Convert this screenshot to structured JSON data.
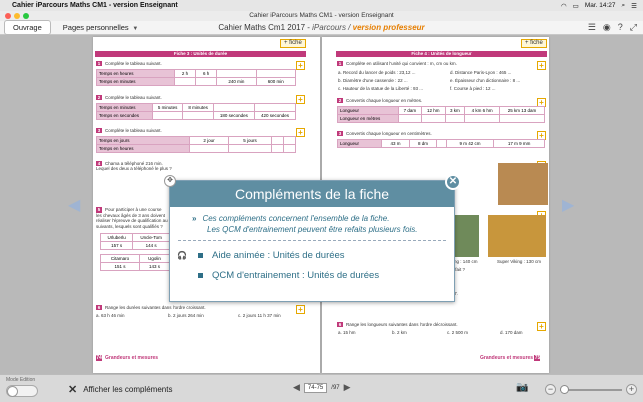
{
  "menubar": {
    "app_name": "Cahier iParcours Maths CM1 - version Enseignant",
    "right_items": [
      "Mar. 14:27"
    ]
  },
  "window": {
    "title": "Cahier iParcours Maths CM1 - version Enseignant"
  },
  "toolbar": {
    "tab_ouvrage": "Ouvrage",
    "tab_pages": "Pages personnelles",
    "doc_title_main": "Cahier Maths Cm1 2017 - ",
    "doc_title_sub": "iParcours / ",
    "doc_title_prof": "version professeur"
  },
  "left_page": {
    "section_title": "Fiche 3 : Unités de durée",
    "fiche_label": "+ fiche",
    "ex1_text": "Complète le tableau suivant.",
    "ex1_rows": [
      {
        "label": "Temps en heures",
        "cells": [
          "2 h",
          "6 h",
          "",
          ""
        ]
      },
      {
        "label": "Temps en minutes",
        "cells": [
          "",
          "",
          "240 min",
          "600 min"
        ]
      }
    ],
    "ex2_text": "Complète le tableau suivant.",
    "ex2_rows": [
      {
        "label": "Temps en minutes",
        "cells": [
          "5 minutes",
          "8 minutes",
          "",
          ""
        ]
      },
      {
        "label": "Temps en secondes",
        "cells": [
          "",
          "",
          "180 secondes",
          "420 secondes"
        ]
      }
    ],
    "ex3_text": "Complète le tableau suivant.",
    "ex3_rows": [
      {
        "label": "Temps en jours",
        "cells": [
          "2 jour",
          "5 jours",
          "",
          ""
        ]
      },
      {
        "label": "Temps en heures",
        "cells": [
          "",
          "",
          "",
          ""
        ]
      }
    ],
    "ex4_text": "Chama a téléphoné 216 min.",
    "ex4_text2": "Lequel des deux a téléphoné le plus ?",
    "ex5_text": "Pour participer à une course les chevaux âgés de 3 ans doivent réaliser l'épreuve de qualification au suivants, lesquels sont qualifiés ?",
    "horse_table": [
      [
        "Urluberlu",
        "Uncle-Tom"
      ],
      [
        "157 s",
        "144 s"
      ],
      [
        "Citamaro",
        "Ugolin"
      ],
      [
        "151 s",
        "143 s"
      ]
    ],
    "ex6_text": "Range les durées suivantes dans l'ordre croissant.",
    "ex6_items": [
      "a. 63 h 46 min",
      "b. 2 jours 264 min",
      "c. 2 jours 11 h 37 min"
    ],
    "footer": "Grandeurs et mesures",
    "page_num": "74"
  },
  "right_page": {
    "section_title": "Fiche 4 : Unités de longueur",
    "fiche_label": "+ fiche",
    "ex1_text": "Complète en utilisant l'unité qui convient : m, cm ou km.",
    "ex1_items": [
      "a. Record du lancer de poids : 23,12 ...",
      "b. Diamètre d'une casserole : 22 ...",
      "c. Hauteur de la statue de la Liberté : 93 ...",
      "d. Distance Paris-Lyon : 465 ...",
      "e. Épaisseur d'un dictionnaire : 8 ...",
      "f. Course à pied : 12 ..."
    ],
    "ex2_text": "Convertis chaque longueur en mètres.",
    "ex2_row_label1": "Longueur",
    "ex2_row_label2": "Longueur en mètres",
    "ex2_cells": [
      "7 dam",
      "12 hm",
      "3 km",
      "4 km 6 hm",
      "25 km 13 dam"
    ],
    "ex3_text": "Convertis chaque longueur en centimètres.",
    "ex3_cells": [
      "43 m",
      "8 dm",
      "",
      "9 m 42 cm",
      "17 m 9 mm"
    ],
    "photo_caption1": "Super Viking : 130 cm",
    "photo_caption2": "ing : 140 cm",
    "photo_caption3": "l fait ?",
    "ex_b_text": "b. Même question pour son amie Amélie qui mesure 1 m 27.",
    "ex6_text": "Range les longueurs suivantes dans l'ordre décroissant.",
    "ex6_items": [
      "a. 15 hm",
      "b. 2 km",
      "c. 2 500 m",
      "d. 170 dam"
    ],
    "footer": "Grandeurs et mesures",
    "page_num": "75"
  },
  "modal": {
    "title": "Compléments de la fiche",
    "intro_line1": "Ces compléments concernent l'ensemble de la fiche.",
    "intro_line2": "Les QCM d'entrainement peuvent être refaits plusieurs fois.",
    "item1": "Aide animée : Unités de durées",
    "item2": "QCM d'entrainement : Unités de durées",
    "close_glyph": "✕"
  },
  "bottombar": {
    "mode_label": "Mode Edition",
    "show_complements": "Afficher les compléments",
    "page_field": "74-75",
    "page_total": "/97"
  },
  "colors": {
    "accent_magenta": "#c0397a",
    "modal_teal": "#5f8ea2",
    "prof_orange": "#e67e00"
  }
}
